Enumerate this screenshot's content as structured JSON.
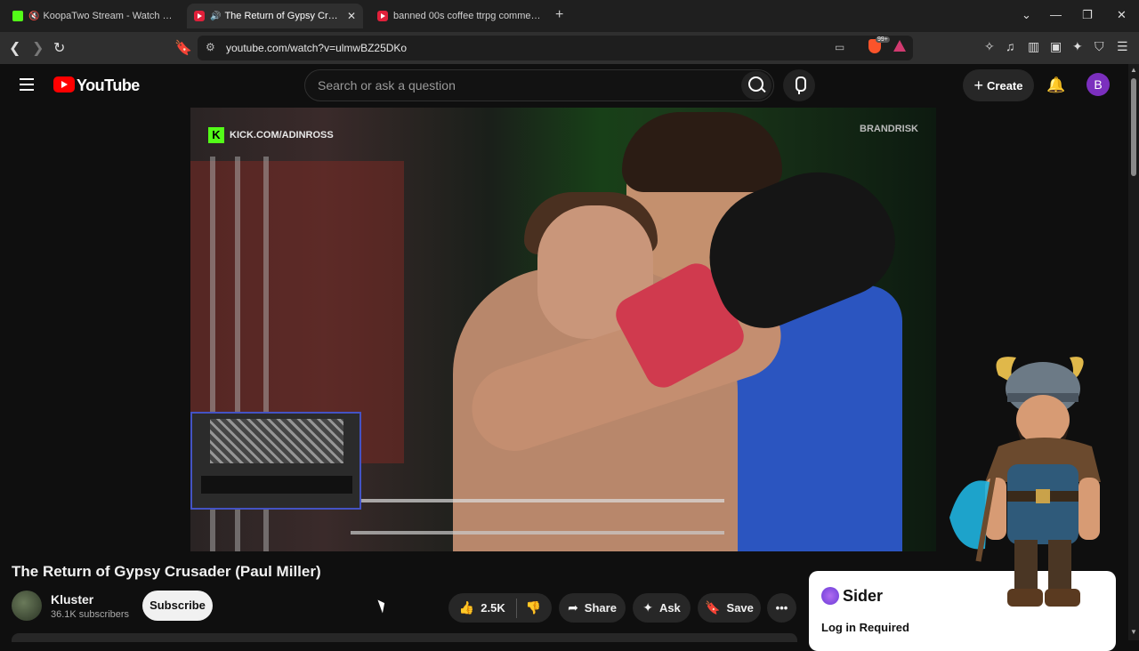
{
  "browser": {
    "tabs": [
      {
        "title": "KoopaTwo Stream - Watch Live o",
        "active": false
      },
      {
        "title": "The Return of Gypsy Crusader",
        "active": true
      },
      {
        "title": "banned 00s coffee ttrpg commercial",
        "active": false
      }
    ],
    "url": "youtube.com/watch?v=ulmwBZ25DKo",
    "brave_badge": "99+"
  },
  "youtube": {
    "logo_text": "YouTube",
    "search_placeholder": "Search or ask a question",
    "create_label": "Create",
    "avatar_letter": "B"
  },
  "video": {
    "overlay_kick": "KICK.COM/ADINROSS",
    "overlay_brand": "BRANDRISK",
    "title": "The Return of Gypsy Crusader (Paul Miller)"
  },
  "channel": {
    "name": "Kluster",
    "subscribers": "36.1K subscribers",
    "subscribe_label": "Subscribe"
  },
  "actions": {
    "likes": "2.5K",
    "share_label": "Share",
    "ask_label": "Ask",
    "save_label": "Save"
  },
  "sider": {
    "brand": "Sider",
    "message": "Log in Required"
  },
  "colors": {
    "accent": "#ff0000",
    "kick_green": "#53fc18",
    "avatar": "#7b2fbe"
  }
}
